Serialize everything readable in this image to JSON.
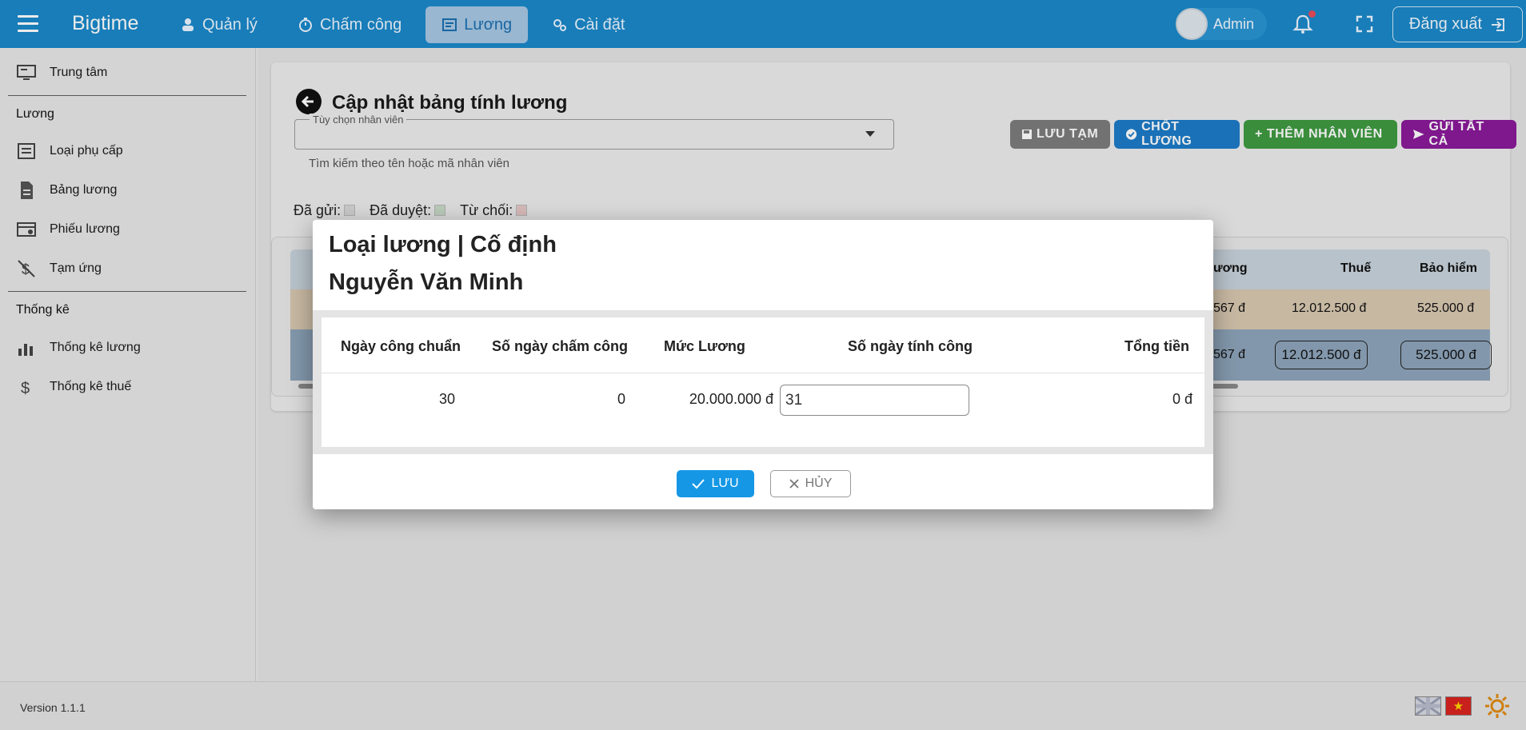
{
  "app": {
    "brand": "Bigtime"
  },
  "topnav": {
    "items": [
      {
        "label": "Quản lý",
        "icon": "user-icon"
      },
      {
        "label": "Chấm công",
        "icon": "stopwatch-icon"
      },
      {
        "label": "Lương",
        "icon": "payroll-icon",
        "active": true
      },
      {
        "label": "Cài đặt",
        "icon": "gears-icon"
      }
    ],
    "user": "Admin",
    "logout": "Đăng xuất"
  },
  "sidebar": {
    "top_item": "Trung tâm",
    "section1": "Lương",
    "salary_items": [
      "Loại phụ cấp",
      "Bảng lương",
      "Phiếu lương",
      "Tạm ứng"
    ],
    "section2": "Thống kê",
    "stat_items": [
      "Thống kê lương",
      "Thống kê thuế"
    ]
  },
  "page": {
    "title": "Cập nhật bảng tính lương",
    "employee_select_label": "Tùy chọn nhân viên",
    "employee_select_hint": "Tìm kiếm theo tên hoặc mã nhân viên",
    "buttons": {
      "save_draft": "LƯU TẠM",
      "finalize": "CHỐT LƯƠNG",
      "add_employee": "THÊM NHÂN VIÊN",
      "send_all": "GỬI TẤT CẢ"
    },
    "legend": {
      "sent": "Đã gửi:",
      "approved": "Đã duyệt:",
      "rejected": "Từ chối:"
    },
    "background_table": {
      "headers": [
        "ương",
        "Thuế",
        "Bảo hiểm"
      ],
      "row1": [
        "567 đ",
        "12.012.500 đ",
        "525.000 đ"
      ],
      "row2": [
        "567 đ",
        "12.012.500 đ",
        "525.000 đ"
      ]
    }
  },
  "modal": {
    "title_line1": "Loại lương | Cố định",
    "title_line2": "Nguyễn Văn Minh",
    "headers": [
      "Ngày công chuẩn",
      "Số ngày chấm công",
      "Mức Lương",
      "Số ngày tính công",
      "Tổng tiền"
    ],
    "row": {
      "standard_days": "30",
      "attendance_days": "0",
      "salary": "20.000.000 đ",
      "working_days_value": "31",
      "total": "0 đ"
    },
    "save": "LƯU",
    "cancel": "HỦY"
  },
  "footer": {
    "version": "Version 1.1.1"
  },
  "colors": {
    "topbar": "#1b88c9",
    "nav_active_bg": "#a7c7e3",
    "btn_gray": "#7c7c7c",
    "btn_blue": "#1d7bc7",
    "btn_green": "#3e9a41",
    "btn_purple": "#8a1a9a",
    "save_button": "#1597e5",
    "legend_sent": "#d9d9d9",
    "legend_approved": "#c9dcc9",
    "legend_rejected": "#e8c8c8"
  }
}
